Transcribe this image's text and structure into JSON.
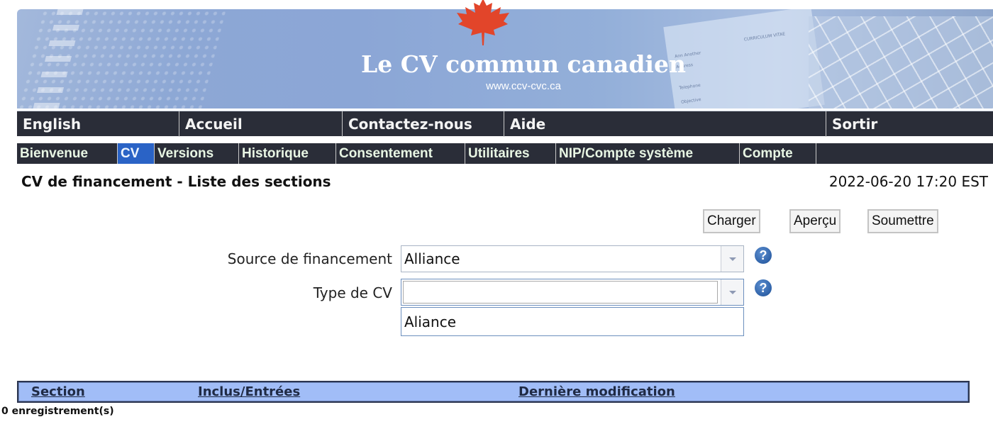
{
  "banner": {
    "title": "Le CV commun canadien",
    "url": "www.ccv-cvc.ca",
    "paper_text": [
      "Ann Another",
      "CURRICULUM VITAE",
      "Address",
      "Telephone",
      "Objective"
    ]
  },
  "top_nav": {
    "items": [
      {
        "label": "English"
      },
      {
        "label": "Accueil"
      },
      {
        "label": "Contactez-nous"
      },
      {
        "label": "Aide"
      },
      {
        "label": "Sortir"
      }
    ]
  },
  "sub_nav": {
    "items": [
      {
        "label": "Bienvenue",
        "active": false
      },
      {
        "label": "CV",
        "active": true
      },
      {
        "label": "Versions",
        "active": false
      },
      {
        "label": "Historique",
        "active": false
      },
      {
        "label": "Consentement",
        "active": false
      },
      {
        "label": "Utilitaires",
        "active": false
      },
      {
        "label": "NIP/Compte système",
        "active": false
      },
      {
        "label": "Compte",
        "active": false
      }
    ]
  },
  "page": {
    "title": "CV de financement - Liste des sections",
    "timestamp": "2022-06-20 17:20 EST"
  },
  "actions": {
    "load": "Charger",
    "preview": "Aperçu",
    "submit": "Soumettre"
  },
  "form": {
    "funding_source": {
      "label": "Source de financement",
      "value": "Alliance"
    },
    "cv_type": {
      "label": "Type de CV",
      "value": "",
      "options": [
        "Aliance"
      ]
    },
    "help_glyph": "?"
  },
  "table": {
    "columns": [
      "Section",
      "Inclus/Entrées",
      "Dernière modification"
    ],
    "record_count": "0 enregistrement(s)"
  },
  "colors": {
    "nav_bg": "#2a2d38",
    "active_tab": "#2a63c6",
    "table_header_bg": "#a1bdf7",
    "maple_leaf": "#e2452a"
  }
}
